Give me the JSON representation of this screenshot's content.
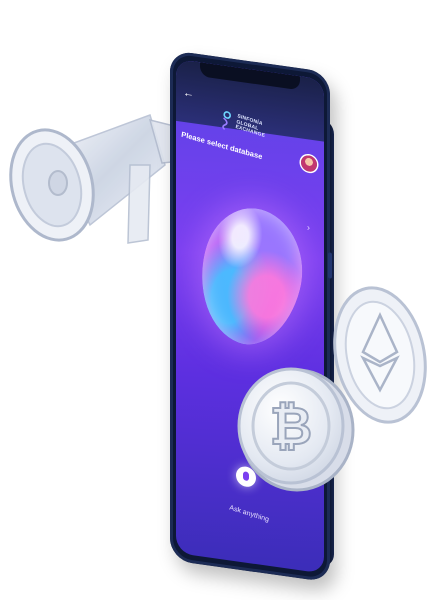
{
  "app": {
    "logo_lines": [
      "SINFONÍA",
      "GLOBAL",
      "EXCHANGE"
    ],
    "back_icon": "back-arrow-icon"
  },
  "screen": {
    "select_label": "Please select database",
    "next_icon": "chevron-right-icon",
    "orb_icon": "holographic-orb-icon",
    "mic_icon": "microphone-icon",
    "ask_placeholder": "Ask anything"
  },
  "decorations": {
    "megaphone": "megaphone-icon",
    "ethereum_coin": "ethereum-coin-icon",
    "bitcoin_coin": "bitcoin-coin-icon"
  },
  "colors": {
    "screen_top": "#1a2148",
    "screen_gradient_start": "#5a43e6",
    "screen_gradient_mid": "#7b3ff0",
    "screen_gradient_end": "#3b2db8",
    "phone_frame": "#0d1836"
  }
}
